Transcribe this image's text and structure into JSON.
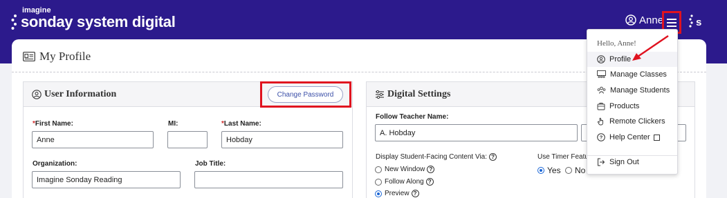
{
  "brand": {
    "small": "imagine",
    "main": "sonday system digital"
  },
  "header": {
    "user_name": "Anne",
    "brand_mark": "s"
  },
  "page": {
    "title": "My Profile"
  },
  "user_info": {
    "title": "User Information",
    "change_password": "Change Password",
    "first_name_label": "First Name:",
    "mi_label": "MI:",
    "last_name_label": "Last Name:",
    "first_name": "Anne",
    "mi": "",
    "last_name": "Hobday",
    "organization_label": "Organization:",
    "job_title_label": "Job Title:",
    "organization": "Imagine Sonday Reading",
    "job_title": ""
  },
  "digital_settings": {
    "title": "Digital Settings",
    "follow_teacher_label": "Follow Teacher Name:",
    "follow_teacher": "A. Hobday",
    "display_label": "Display Student-Facing Content Via:",
    "display_options": [
      "New Window",
      "Follow Along",
      "Preview"
    ],
    "display_selected": "Preview",
    "timer_label": "Use Timer Featu",
    "timer_options": [
      "Yes",
      "No"
    ],
    "timer_selected": "Yes"
  },
  "menu": {
    "greeting": "Hello, Anne!",
    "items": [
      {
        "label": "Profile",
        "icon": "user-circle-icon"
      },
      {
        "label": "Manage Classes",
        "icon": "classroom-icon"
      },
      {
        "label": "Manage Students",
        "icon": "students-icon"
      },
      {
        "label": "Products",
        "icon": "products-icon"
      },
      {
        "label": "Remote Clickers",
        "icon": "clicker-hand-icon"
      },
      {
        "label": "Help Center",
        "icon": "help-icon"
      },
      {
        "label": "Sign Out",
        "icon": "sign-out-icon"
      }
    ]
  },
  "colors": {
    "header_bg": "#2c1a8c",
    "highlight": "#e0121f",
    "accent_blue": "#1a66d6",
    "required": "#d12a2a"
  }
}
